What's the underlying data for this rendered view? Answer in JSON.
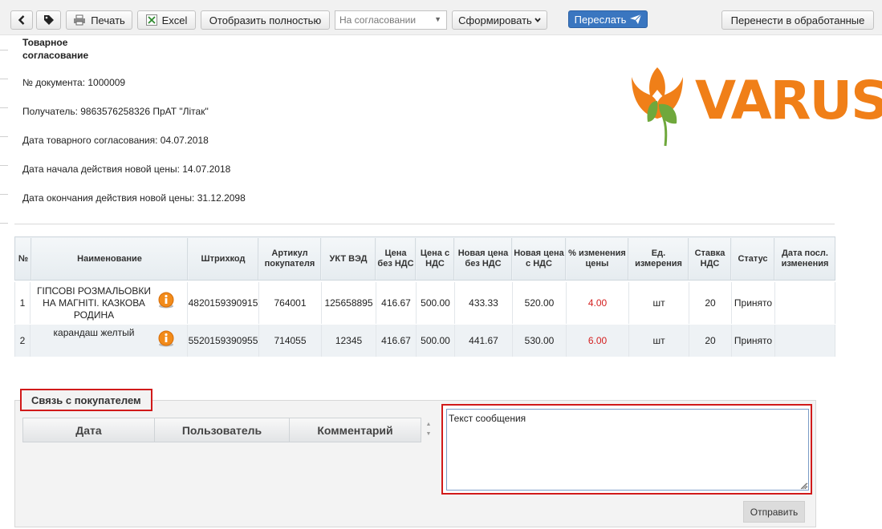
{
  "toolbar": {
    "back_icon": "chevron-left-icon",
    "tag_icon": "tag-icon",
    "print_label": "Печать",
    "excel_label": "Excel",
    "show_full_label": "Отобразить полностью",
    "status_select_value": "На согласовании",
    "form_label": "Сформировать",
    "forward_label": "Переслать",
    "move_label": "Перенести в обработанные"
  },
  "document": {
    "title": "Товарное согласование",
    "number": "№ документа: 1000009",
    "recipient": "Получатель: 9863576258326 ПрАТ \"Літак\"",
    "agreement_date": "Дата товарного согласования: 04.07.2018",
    "price_start": "Дата начала действия новой цены: 14.07.2018",
    "price_end": "Дата окончания действия новой цены: 31.12.2098"
  },
  "logo": {
    "brand": "VARUS",
    "colors": {
      "orange": "#f07f18",
      "green": "#6fa83c"
    }
  },
  "table": {
    "headers": [
      "№",
      "Наименование",
      "Штрихкод",
      "Артикул покупателя",
      "УКТ ВЭД",
      "Цена без НДС",
      "Цена с НДС",
      "Новая цена без НДС",
      "Новая цена с НДС",
      "% изменения цены",
      "Ед. измерения",
      "Ставка НДС",
      "Статус",
      "Дата посл. изменения"
    ],
    "rows": [
      {
        "n": "1",
        "name": "ГІПСОВІ РОЗМАЛЬОВКИ НА МАГНІТІ. КАЗКОВА РОДИНА",
        "barcode": "4820159390915",
        "article": "764001",
        "ukt": "125658895",
        "price": "416.67",
        "price_vat": "500.00",
        "new_price": "433.33",
        "new_price_vat": "520.00",
        "change": "4.00",
        "unit": "шт",
        "vat": "20",
        "status": "Принято",
        "changed": ""
      },
      {
        "n": "2",
        "name": "карандаш желтый",
        "barcode": "5520159390955",
        "article": "714055",
        "ukt": "12345",
        "price": "416.67",
        "price_vat": "500.00",
        "new_price": "441.67",
        "new_price_vat": "530.00",
        "change": "6.00",
        "unit": "шт",
        "vat": "20",
        "status": "Принято",
        "changed": ""
      }
    ],
    "info_icon": "info-icon",
    "change_color": "#d42020"
  },
  "communication": {
    "title": "Связь с покупателем",
    "headers": [
      "Дата",
      "Пользователь",
      "Комментарий"
    ],
    "message_value": "Текст сообщения",
    "send_label": "Отправить",
    "highlight_color": "#d11a1a"
  }
}
